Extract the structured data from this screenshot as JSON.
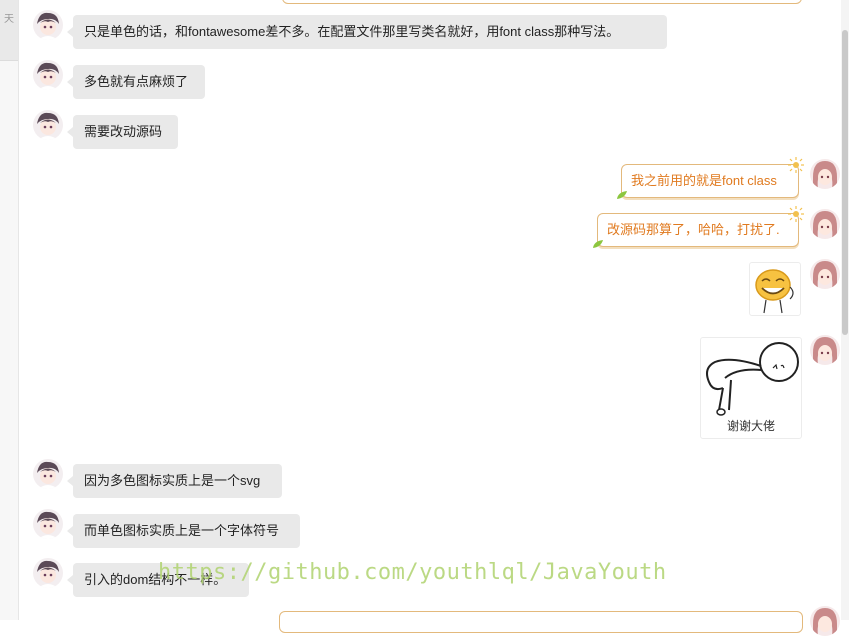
{
  "sidebar": {
    "tab_label": "天"
  },
  "messages_left": [
    {
      "text": "只是单色的话，和fontawesome差不多。在配置文件那里写类名就好，用font class那种写法。"
    },
    {
      "text": "多色就有点麻烦了"
    },
    {
      "text": "需要改动源码"
    },
    {
      "text": "因为多色图标实质上是一个svg"
    },
    {
      "text": "而单色图标实质上是一个字体符号"
    },
    {
      "text": "引入的dom结构不一样。"
    }
  ],
  "messages_right": [
    {
      "text": "我之前用的就是font class"
    },
    {
      "text": "改源码那算了，哈哈，打扰了."
    }
  ],
  "stickers": {
    "smiley": {
      "icon": "smiley-sticker-icon"
    },
    "bow": {
      "icon": "bowing-stickman-sticker-icon",
      "caption": "谢谢大佬"
    }
  },
  "watermark": {
    "text": "https://github.com/youthlql/JavaYouth"
  },
  "colors": {
    "left_bubble_bg": "#e9e9e9",
    "right_bubble_border": "#e3b97c",
    "right_bubble_text": "#e07a1f",
    "watermark": "#afd26e"
  }
}
